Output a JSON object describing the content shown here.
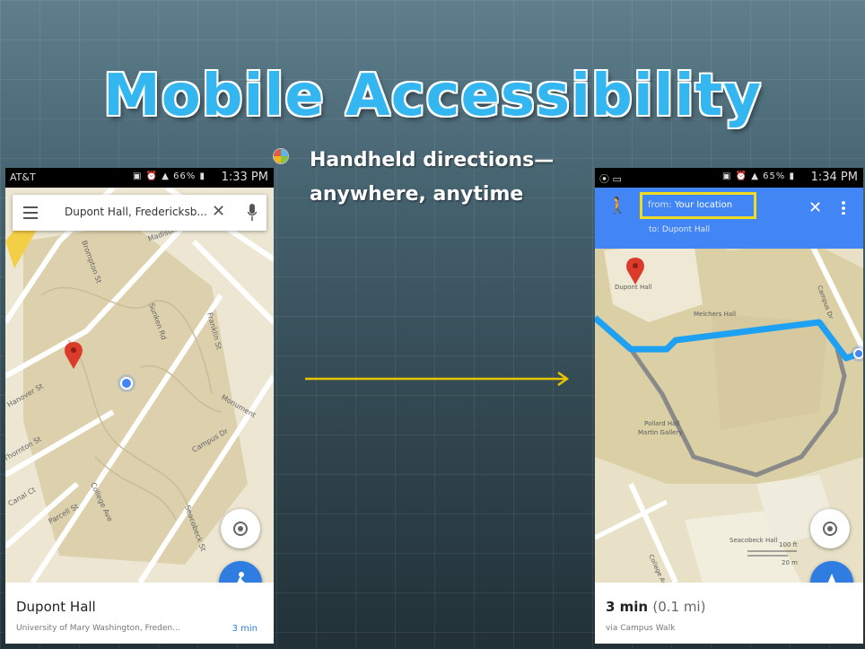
{
  "slide": {
    "title": "Mobile Accessibility",
    "bullet": "Handheld directions—anywhere, anytime"
  },
  "left_phone": {
    "status": {
      "carrier": "AT&T",
      "time": "1:33 PM",
      "battery": "66%"
    },
    "search": {
      "value": "Dupont Hall, Fredericksb...",
      "icons": [
        "menu-icon",
        "close-icon",
        "mic-icon"
      ]
    },
    "map_labels": [
      "Madison St",
      "Sunken Rd",
      "Franklin St",
      "Monument",
      "Campus Dr",
      "College Ave",
      "Parcell St",
      "Hanover St",
      "Thornton St",
      "Brompton St",
      "Canal Ct",
      "Seacobeck St"
    ],
    "place": {
      "name": "Dupont Hall",
      "subtitle": "University of Mary Washington, Freden...",
      "time": "3 min"
    }
  },
  "right_phone": {
    "status": {
      "time": "1:34 PM",
      "battery": "65%"
    },
    "directions": {
      "from_label": "from:",
      "from_value": "Your location",
      "to": "to: Dupont Hall"
    },
    "map_labels": [
      "Dupont Hall",
      "Melchers Hall",
      "Campus Dr",
      "Pollard Hall",
      "Martin Gallery",
      "Seacobeck Hall",
      "College Ave",
      "100 ft",
      "20 m"
    ],
    "route": {
      "time": "3 min",
      "distance": "(0.1 mi)",
      "via": "via Campus Walk"
    }
  },
  "colors": {
    "title": "#34b6f0",
    "route_blue": "#1ea1f2",
    "route_gray": "#8a8a8a",
    "header_blue": "#4285f4",
    "highlight": "#f0dc1e",
    "arrow": "#e8c400",
    "pin": "#db3b2b"
  }
}
